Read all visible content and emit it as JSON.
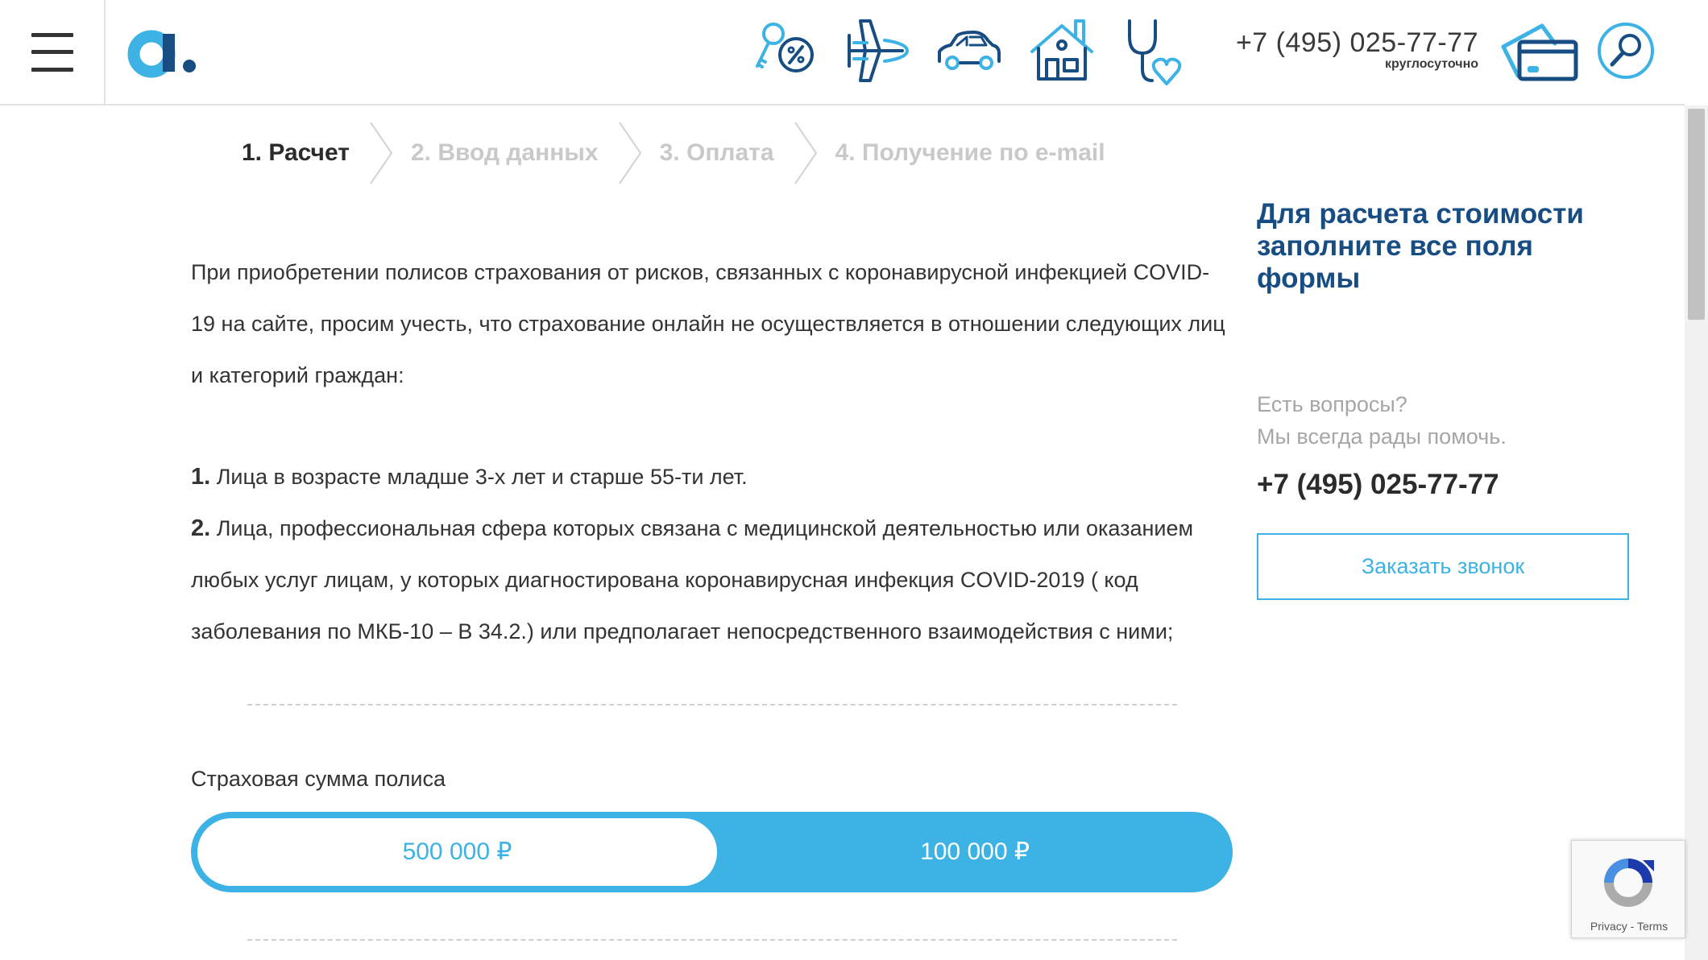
{
  "header": {
    "menu_icon": "hamburger-icon",
    "logo_letter": "a",
    "nav_icons": [
      "keys-percent-icon",
      "plane-icon",
      "car-icon",
      "house-icon",
      "stethoscope-heart-icon"
    ],
    "phone": "+7 (495) 025-77-77",
    "phone_note": "круглосуточно",
    "card_icon": "payment-card-icon",
    "search_icon": "magnifier-icon"
  },
  "steps": [
    {
      "label": "1. Расчет",
      "active": true
    },
    {
      "label": "2. Ввод данных",
      "active": false
    },
    {
      "label": "3. Оплата",
      "active": false
    },
    {
      "label": "4. Получение по e-mail",
      "active": false
    }
  ],
  "intro": "При приобретении полисов страхования от рисков, связанных с коронавирусной инфекцией COVID-19 на сайте, просим учесть, что страхование онлайн не осуществляется в отношении следующих лиц и категорий граждан:",
  "rules": [
    {
      "num": "1.",
      "text": "Лица в возрасте младше 3-х лет и старше 55-ти лет."
    },
    {
      "num": "2.",
      "text": "Лица, профессиональная сфера которых связана с медицинской деятельностью или оказанием любых услуг лицам, у которых диагностирована коронавирусная инфекция COVID-2019 ( код заболевания по МКБ-10 – В 34.2.) или предполагает непосредственного взаимодействия с ними;"
    }
  ],
  "sum": {
    "label": "Страховая сумма полиса",
    "options": [
      "500 000 ₽",
      "100 000 ₽"
    ],
    "selected": "500 000 ₽"
  },
  "sidebar": {
    "title": "Для расчета стоимости заполните все поля формы",
    "question_line1": "Есть вопросы?",
    "question_line2": "Мы всегда рады помочь.",
    "phone": "+7 (495) 025-77-77",
    "callback_label": "Заказать звонок"
  },
  "recaptcha": {
    "privacy": "Privacy",
    "separator": " - ",
    "terms": "Terms"
  },
  "colors": {
    "accent": "#3db2e4",
    "brand_dark": "#174d82",
    "muted": "#c9c9c9"
  }
}
